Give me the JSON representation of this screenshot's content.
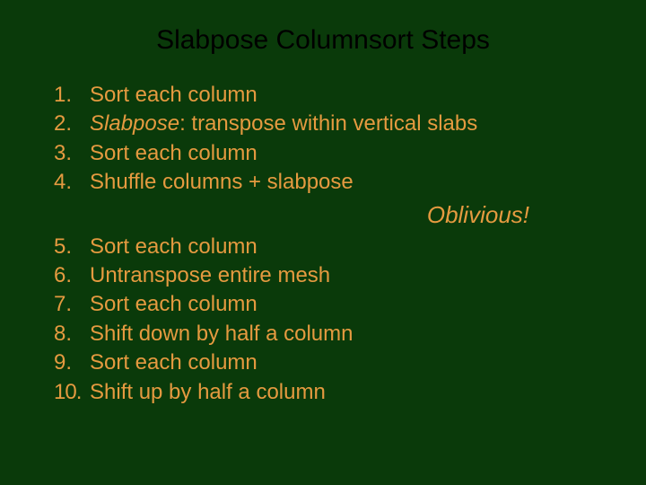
{
  "title": "Slabpose Columnsort Steps",
  "steps": {
    "s1": {
      "n": "1.",
      "t": "Sort each column"
    },
    "s2": {
      "n": "2.",
      "prefix": "Slabpose",
      "rest": ": transpose within vertical slabs"
    },
    "s3": {
      "n": "3.",
      "t": "Sort each column"
    },
    "s4": {
      "n": "4.",
      "t": "Shuffle columns + slabpose"
    },
    "s5": {
      "n": "5.",
      "t": "Sort each column"
    },
    "s6": {
      "n": "6.",
      "t": "Untranspose entire mesh"
    },
    "s7": {
      "n": "7.",
      "t": "Sort each column"
    },
    "s8": {
      "n": "8.",
      "t": "Shift down by half a column"
    },
    "s9": {
      "n": "9.",
      "t": "Sort each column"
    },
    "s10": {
      "n": "10.",
      "t": "Shift up by half a column"
    }
  },
  "callout": "Oblivious!"
}
